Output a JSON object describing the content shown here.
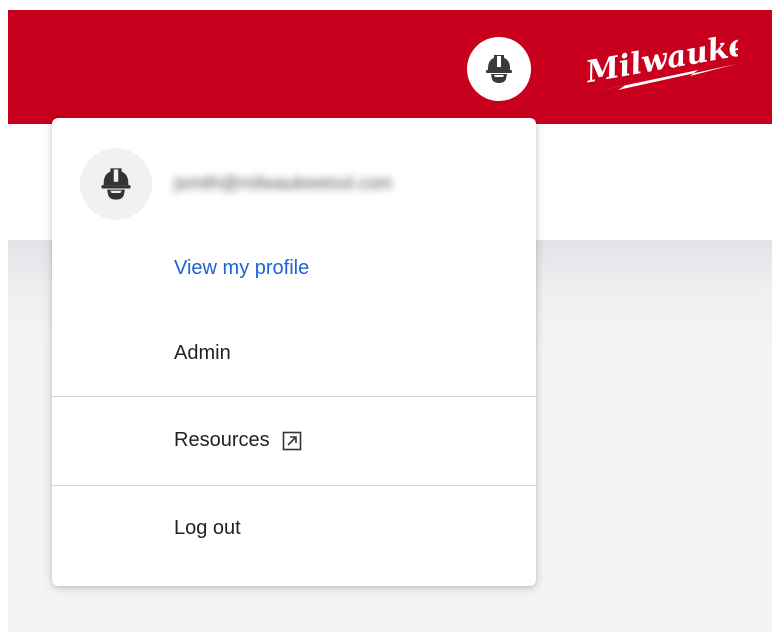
{
  "header": {
    "brand_color": "#c8001e",
    "logo_text": "Milwaukee",
    "avatar_icon": "hardhat-icon"
  },
  "menu": {
    "user_email": "jsmith@milwaukeetool.com",
    "avatar_icon": "hardhat-icon",
    "items": [
      {
        "label": "View my profile",
        "color": "#1f62d8"
      },
      {
        "label": "Admin"
      },
      {
        "label": "Resources",
        "icon": "external-link-icon"
      },
      {
        "label": "Log out"
      }
    ]
  }
}
